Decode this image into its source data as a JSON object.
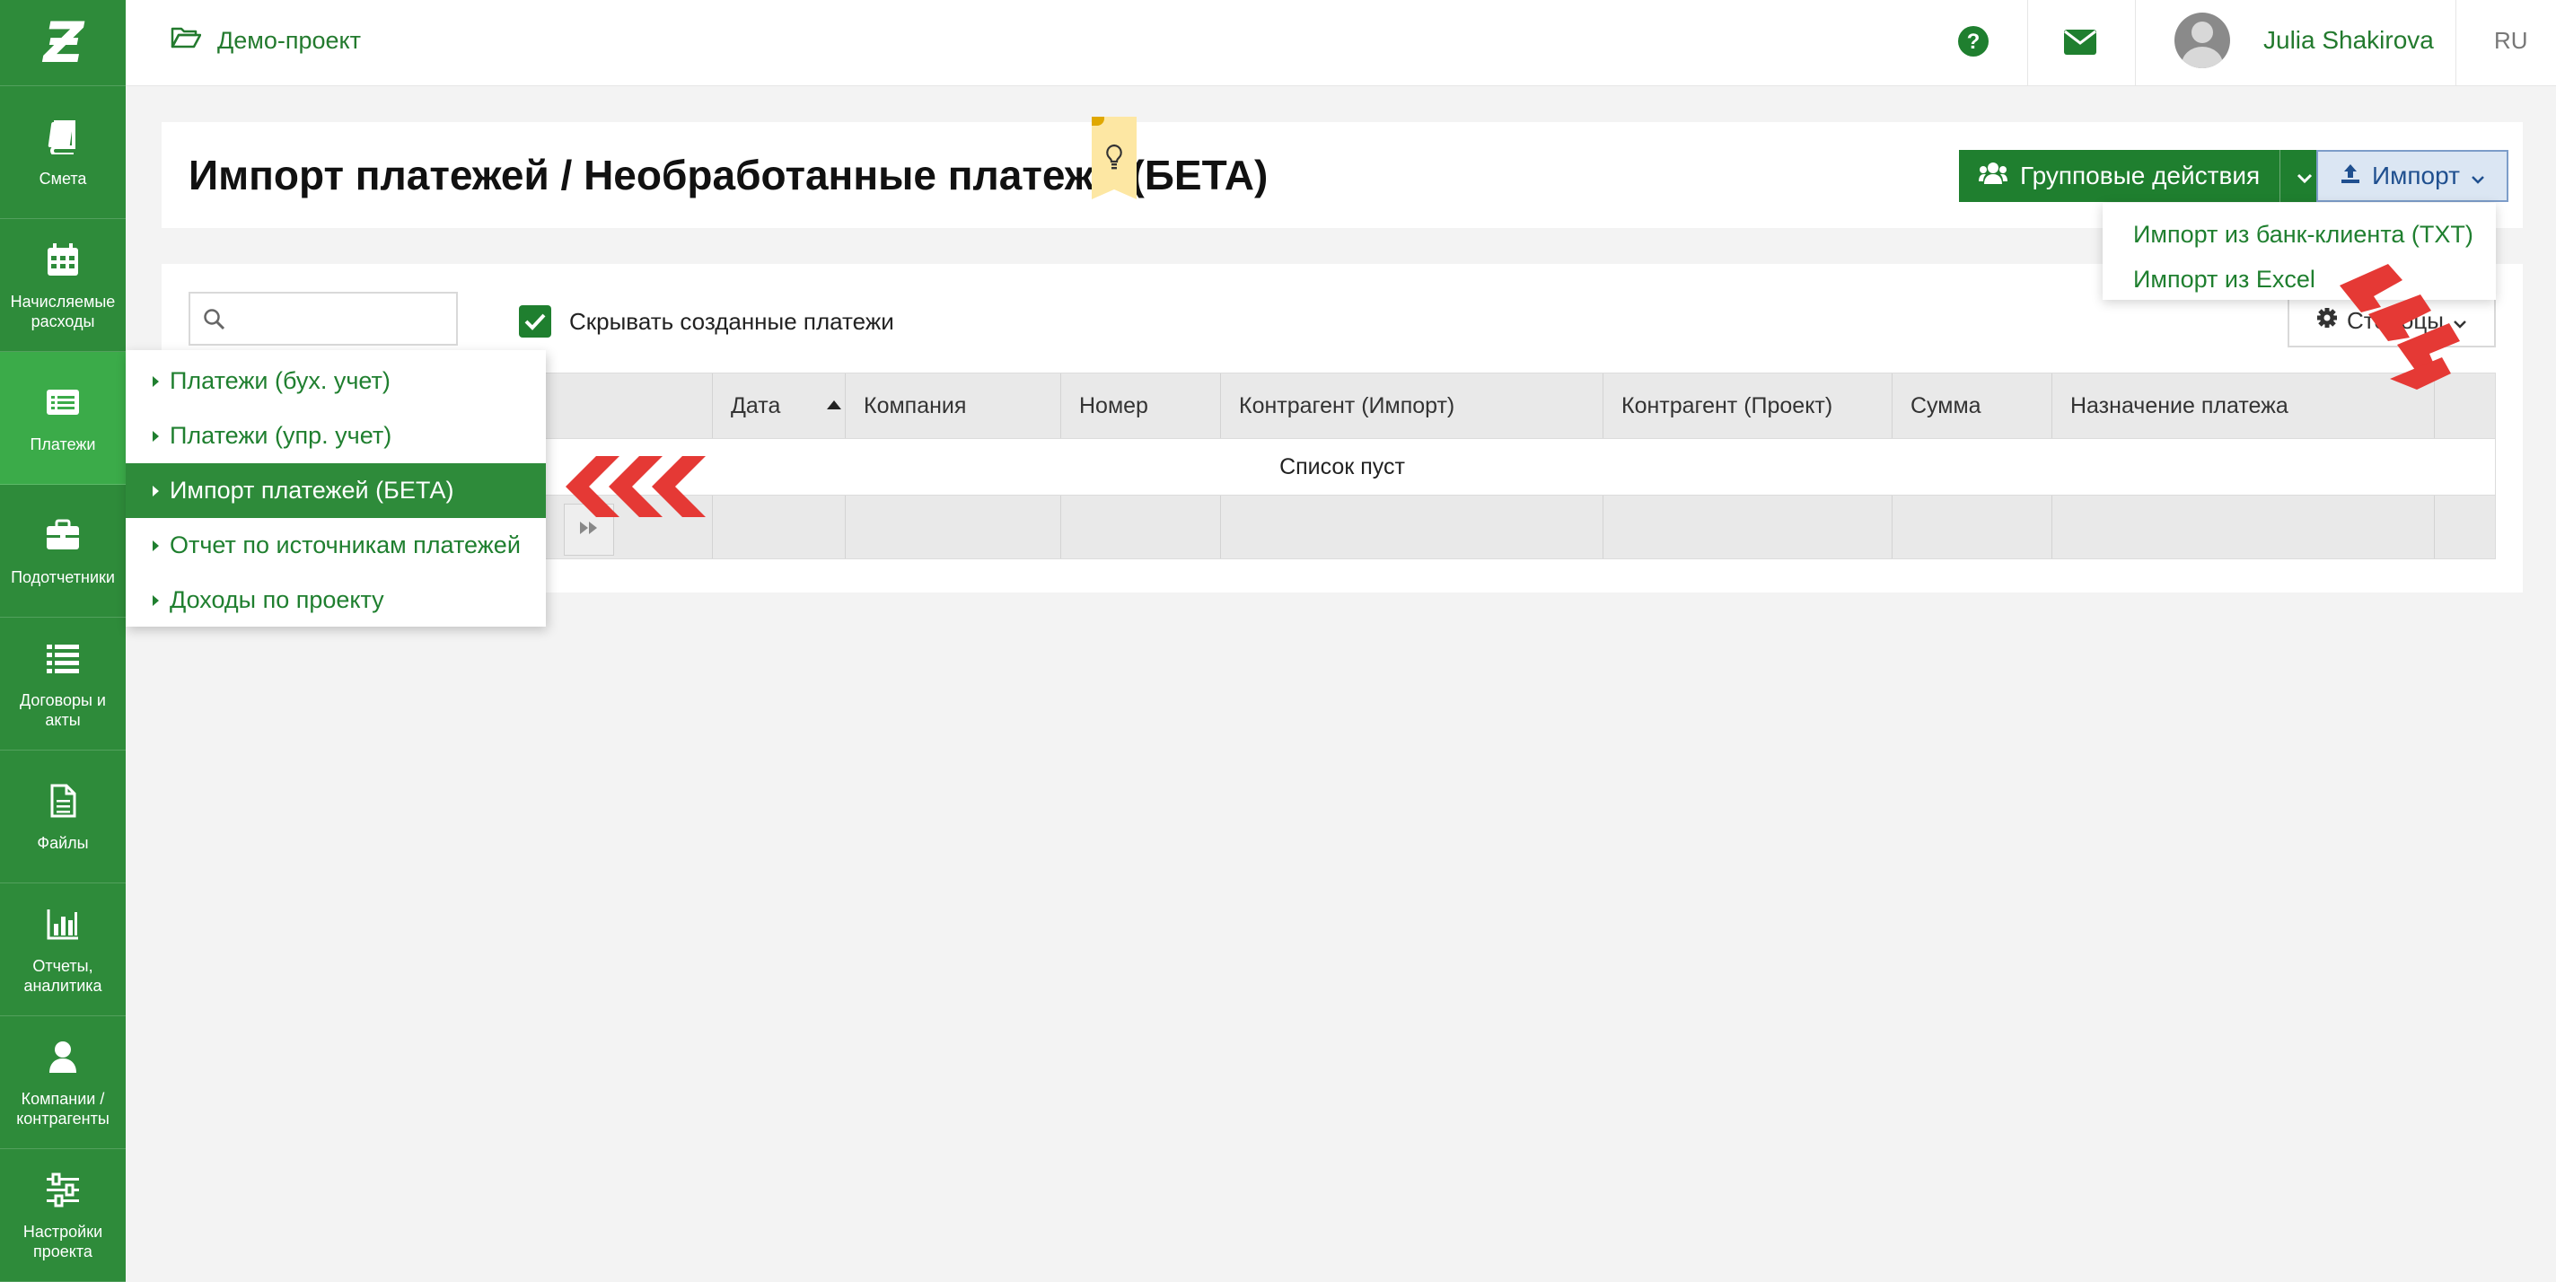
{
  "sidebar": {
    "logo": "Ƶ",
    "items": [
      {
        "label": "Смета",
        "icon": "book-icon"
      },
      {
        "label": "Начисляемые расходы",
        "icon": "calendar-icon"
      },
      {
        "label": "Платежи",
        "icon": "payments-icon"
      },
      {
        "label": "Подотчетники",
        "icon": "briefcase-icon"
      },
      {
        "label": "Договоры и акты",
        "icon": "list-icon"
      },
      {
        "label": "Файлы",
        "icon": "file-icon"
      },
      {
        "label": "Отчеты, аналитика",
        "icon": "bar-chart-icon"
      },
      {
        "label": "Компании / контрагенты",
        "icon": "user-icon"
      },
      {
        "label": "Настройки проекта",
        "icon": "sliders-icon"
      }
    ]
  },
  "topbar": {
    "project": "Демо-проект",
    "user_name": "Julia Shakirova",
    "lang": "RU"
  },
  "header": {
    "title": "Импорт платежей / Необработанные платежи (БЕТА)",
    "group_actions": "Групповые действия",
    "import_label": "Импорт",
    "import_menu": [
      "Импорт из банк-клиента (TXT)",
      "Импорт из Excel"
    ]
  },
  "filters": {
    "search_placeholder": "",
    "hide_created": "Скрывать созданные платежи",
    "columns_button": "Столбцы"
  },
  "table": {
    "columns": [
      "Дата",
      "Компания",
      "Номер",
      "Контрагент (Импорт)",
      "Контрагент (Проект)",
      "Сумма",
      "Назначение платежа"
    ],
    "empty_text": "Список пуст"
  },
  "flyout": {
    "items": [
      "Платежи (бух. учет)",
      "Платежи (упр. учет)",
      "Импорт платежей (БЕТА)",
      "Отчет по источникам платежей",
      "Доходы по проекту"
    ],
    "active_index": 2
  },
  "colors": {
    "brand_green": "#2e8b3a",
    "dark_green": "#1f7f2f",
    "active_sidebar": "#3bab49",
    "annotation_red": "#e53935"
  }
}
